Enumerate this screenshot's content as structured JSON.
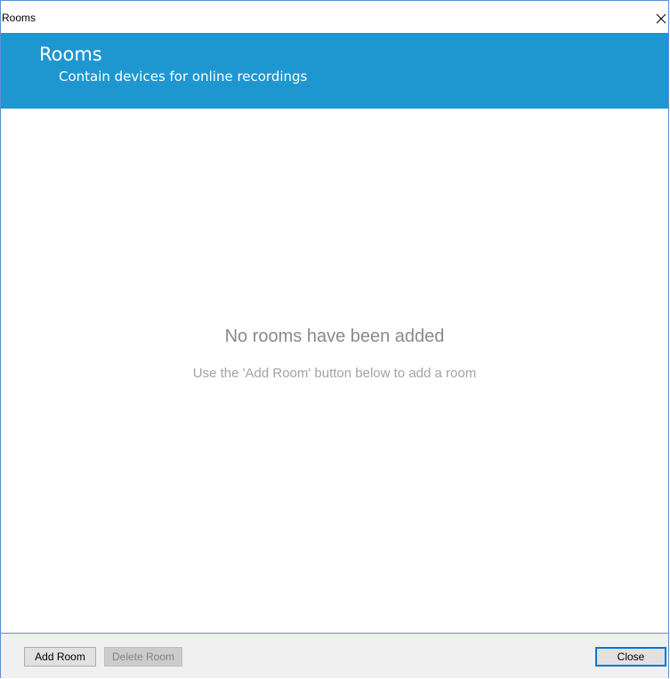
{
  "window": {
    "title": "Rooms"
  },
  "header": {
    "title": "Rooms",
    "subtitle": "Contain devices for online recordings",
    "background_color": "#1e97d0"
  },
  "empty_state": {
    "title": "No rooms have been added",
    "hint": "Use the 'Add Room' button below to add a room"
  },
  "footer": {
    "add_room_label": "Add Room",
    "delete_room_label": "Delete Room",
    "delete_room_enabled": false,
    "close_label": "Close"
  },
  "icons": {
    "close": "close-icon"
  }
}
